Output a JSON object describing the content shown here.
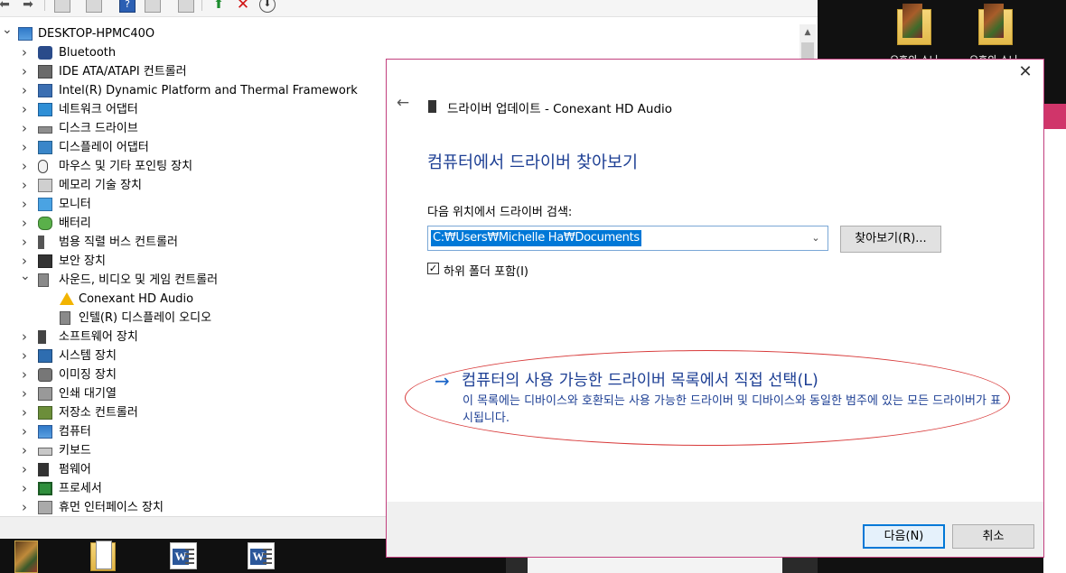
{
  "device_manager": {
    "toolbar_icons": [
      "back-arrow-icon",
      "forward-arrow-icon",
      "properties-icon",
      "view-icon",
      "help-icon",
      "show-hidden-icon",
      "monitor-icon",
      "update-driver-icon",
      "uninstall-icon",
      "scan-icon"
    ],
    "tree": [
      {
        "label": "DESKTOP-HPMC40O",
        "icon": "computer-icon",
        "expander": "v",
        "level": 0
      },
      {
        "label": "Bluetooth",
        "icon": "bluetooth-icon",
        "expander": ">",
        "level": 1
      },
      {
        "label": "IDE ATA/ATAPI 컨트롤러",
        "icon": "ide-icon",
        "expander": ">",
        "level": 1
      },
      {
        "label": "Intel(R) Dynamic Platform and Thermal Framework",
        "icon": "intel-icon",
        "expander": ">",
        "level": 1
      },
      {
        "label": "네트워크 어댑터",
        "icon": "network-icon",
        "expander": ">",
        "level": 1
      },
      {
        "label": "디스크 드라이브",
        "icon": "disk-icon",
        "expander": ">",
        "level": 1
      },
      {
        "label": "디스플레이 어댑터",
        "icon": "display-icon",
        "expander": ">",
        "level": 1
      },
      {
        "label": "마우스 및 기타 포인팅 장치",
        "icon": "mouse-icon",
        "expander": ">",
        "level": 1
      },
      {
        "label": "메모리 기술 장치",
        "icon": "memory-icon",
        "expander": ">",
        "level": 1
      },
      {
        "label": "모니터",
        "icon": "monitor-icon",
        "expander": ">",
        "level": 1
      },
      {
        "label": "배터리",
        "icon": "battery-icon",
        "expander": ">",
        "level": 1
      },
      {
        "label": "범용 직렬 버스 컨트롤러",
        "icon": "usb-icon",
        "expander": ">",
        "level": 1
      },
      {
        "label": "보안 장치",
        "icon": "security-icon",
        "expander": ">",
        "level": 1
      },
      {
        "label": "사운드, 비디오 및 게임 컨트롤러",
        "icon": "sound-icon",
        "expander": "v",
        "level": 1
      },
      {
        "label": "Conexant HD Audio",
        "icon": "warning-icon",
        "expander": "",
        "level": 2
      },
      {
        "label": "인텔(R) 디스플레이 오디오",
        "icon": "speaker-icon",
        "expander": "",
        "level": 2
      },
      {
        "label": "소프트웨어 장치",
        "icon": "software-icon",
        "expander": ">",
        "level": 1
      },
      {
        "label": "시스템 장치",
        "icon": "system-icon",
        "expander": ">",
        "level": 1
      },
      {
        "label": "이미징 장치",
        "icon": "imaging-icon",
        "expander": ">",
        "level": 1
      },
      {
        "label": "인쇄 대기열",
        "icon": "printer-icon",
        "expander": ">",
        "level": 1
      },
      {
        "label": "저장소 컨트롤러",
        "icon": "storage-icon",
        "expander": ">",
        "level": 1
      },
      {
        "label": "컴퓨터",
        "icon": "computer-icon",
        "expander": ">",
        "level": 1
      },
      {
        "label": "키보드",
        "icon": "keyboard-icon",
        "expander": ">",
        "level": 1
      },
      {
        "label": "펌웨어",
        "icon": "firmware-icon",
        "expander": ">",
        "level": 1
      },
      {
        "label": "프로세서",
        "icon": "processor-icon",
        "expander": ">",
        "level": 1
      },
      {
        "label": "휴먼 인터페이스 장치",
        "icon": "hid-icon",
        "expander": ">",
        "level": 1
      }
    ]
  },
  "dialog": {
    "close_glyph": "✕",
    "back_glyph": "←",
    "title": "드라이버 업데이트 - Conexant HD Audio",
    "heading": "컴퓨터에서 드라이버 찾아보기",
    "search_label": "다음 위치에서 드라이버 검색:",
    "path_value": "C:₩Users₩Michelle Ha₩Documents",
    "browse_label": "찾아보기(R)...",
    "include_subfolders": {
      "label": "하위 폴더 포함(I)",
      "checked": true
    },
    "pick_link": {
      "arrow": "→",
      "title": "컴퓨터의 사용 가능한 드라이버 목록에서 직접 선택(L)",
      "description": "이 목록에는 디바이스와 호환되는 사용 가능한 드라이버 및 디바이스와 동일한 범주에 있는 모든 드라이버가 표시됩니다."
    },
    "next_label": "다음(N)",
    "cancel_label": "취소",
    "accent_color": "#1d3f94",
    "annotation_color": "#d83a3a"
  },
  "desktop": {
    "icons": [
      {
        "label": "오후의 소나"
      },
      {
        "label": "오후의 소나"
      }
    ]
  },
  "taskbar": {
    "apps": [
      "photo-thumbnail-icon",
      "folder-icon",
      "word-icon",
      "word-icon"
    ]
  }
}
